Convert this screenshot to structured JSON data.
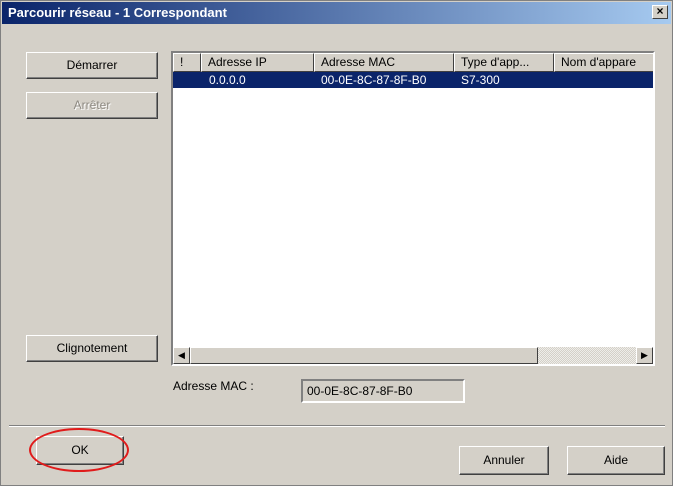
{
  "window": {
    "title": "Parcourir réseau - 1 Correspondant",
    "close_glyph": "×"
  },
  "actions": {
    "start_label": "Démarrer",
    "stop_label": "Arrêter",
    "blink_label": "Clignotement"
  },
  "table": {
    "columns": [
      "!",
      "Adresse IP",
      "Adresse MAC",
      "Type d'app...",
      "Nom d'appare"
    ],
    "rows": [
      {
        "flag": "",
        "ip": "0.0.0.0",
        "mac": "00-0E-8C-87-8F-B0",
        "type": "S7-300",
        "name": ""
      }
    ]
  },
  "mac_address": {
    "label": "Adresse MAC :",
    "value": "00-0E-8C-87-8F-B0"
  },
  "footer": {
    "ok_label": "OK",
    "cancel_label": "Annuler",
    "help_label": "Aide"
  },
  "colors": {
    "selection": "#0a246a",
    "annotation_circle": "#e01b1b"
  }
}
